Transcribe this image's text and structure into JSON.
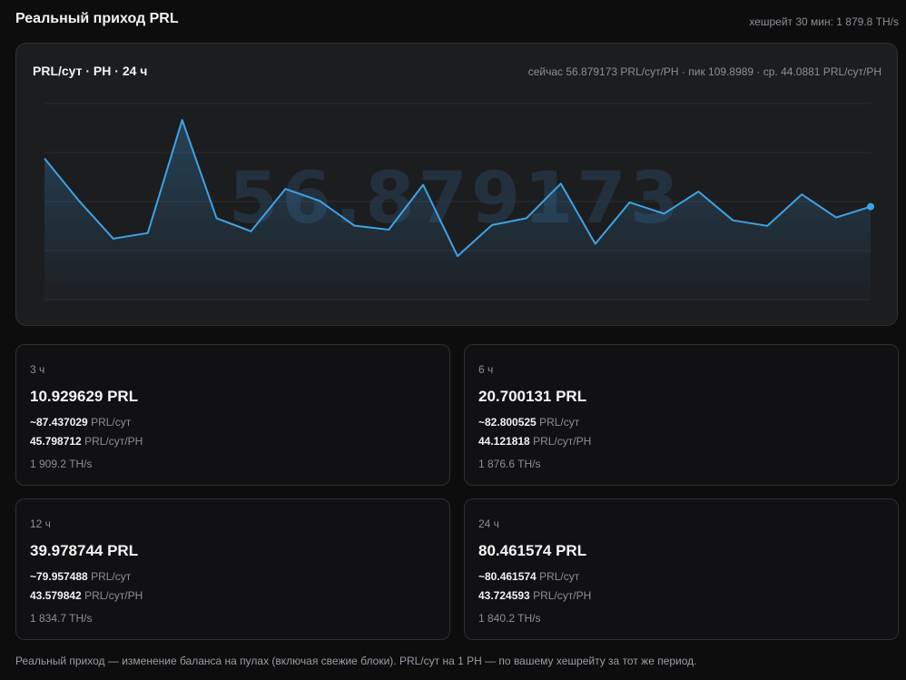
{
  "header": {
    "title": "Реальный приход PRL",
    "hashrate_30": "хешрейт 30 мин: 1 879.8 TH/s"
  },
  "chart_card": {
    "title": "PRL/сут · PH · 24 ч",
    "stats": "сейчас 56.879173 PRL/сут/PH · пик 109.8989 · ср. 44.0881 PRL/сут/PH",
    "watermark": "56.879173"
  },
  "colors": {
    "accent": "#3fa2e6",
    "background": "#0d0d0e",
    "card": "#1c1d1f"
  },
  "chart_data": {
    "type": "area",
    "title": "PRL/сут · PH · 24 ч",
    "xlabel": "",
    "ylabel": "",
    "ylim": [
      0,
      120
    ],
    "grid": true,
    "values": [
      86.4,
      60.5,
      37.3,
      40.7,
      109.9,
      49.8,
      41.8,
      67.7,
      60.4,
      45.3,
      42.8,
      70.3,
      26.6,
      45.6,
      49.8,
      71.0,
      34.1,
      59.5,
      52.6,
      66.1,
      48.5,
      45.1,
      64.4,
      50.2,
      56.9
    ]
  },
  "cards": [
    {
      "period": "3 ч",
      "amount": "10.929629 PRL",
      "per_day_value": "~87.437029",
      "per_day_unit": "PRL/сут",
      "per_ph_value": "45.798712",
      "per_ph_unit": "PRL/сут/PH",
      "hashrate": "1 909.2 TH/s"
    },
    {
      "period": "6 ч",
      "amount": "20.700131 PRL",
      "per_day_value": "~82.800525",
      "per_day_unit": "PRL/сут",
      "per_ph_value": "44.121818",
      "per_ph_unit": "PRL/сут/PH",
      "hashrate": "1 876.6 TH/s"
    },
    {
      "period": "12 ч",
      "amount": "39.978744 PRL",
      "per_day_value": "~79.957488",
      "per_day_unit": "PRL/сут",
      "per_ph_value": "43.579842",
      "per_ph_unit": "PRL/сут/PH",
      "hashrate": "1 834.7 TH/s"
    },
    {
      "period": "24 ч",
      "amount": "80.461574 PRL",
      "per_day_value": "~80.461574",
      "per_day_unit": "PRL/сут",
      "per_ph_value": "43.724593",
      "per_ph_unit": "PRL/сут/PH",
      "hashrate": "1 840.2 TH/s"
    }
  ],
  "footnote": "Реальный приход — изменение баланса на пулах (включая свежие блоки). PRL/сут на 1 PH — по вашему хешрейту за тот же период."
}
